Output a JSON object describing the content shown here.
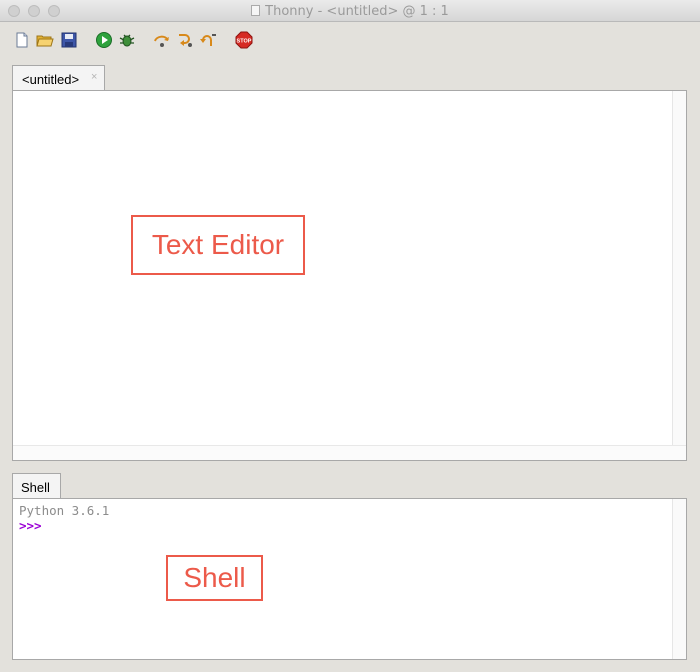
{
  "window": {
    "title": "Thonny  -  <untitled>  @  1 : 1"
  },
  "toolbar": {
    "buttons": [
      {
        "name": "new-file-icon"
      },
      {
        "name": "open-folder-icon"
      },
      {
        "name": "save-icon"
      },
      {
        "name": "run-icon"
      },
      {
        "name": "debug-icon"
      },
      {
        "name": "step-over-icon"
      },
      {
        "name": "step-into-icon"
      },
      {
        "name": "step-out-icon"
      },
      {
        "name": "stop-icon",
        "label": "STOP"
      }
    ]
  },
  "editor": {
    "tab_label": "<untitled>",
    "tab_close": "×",
    "annotation": "Text Editor"
  },
  "shell": {
    "tab_label": "Shell",
    "banner": "Python 3.6.1",
    "prompt": ">>>",
    "annotation": "Shell"
  },
  "colors": {
    "annotation": "#ec5a4a",
    "prompt": "#9b00d6"
  }
}
